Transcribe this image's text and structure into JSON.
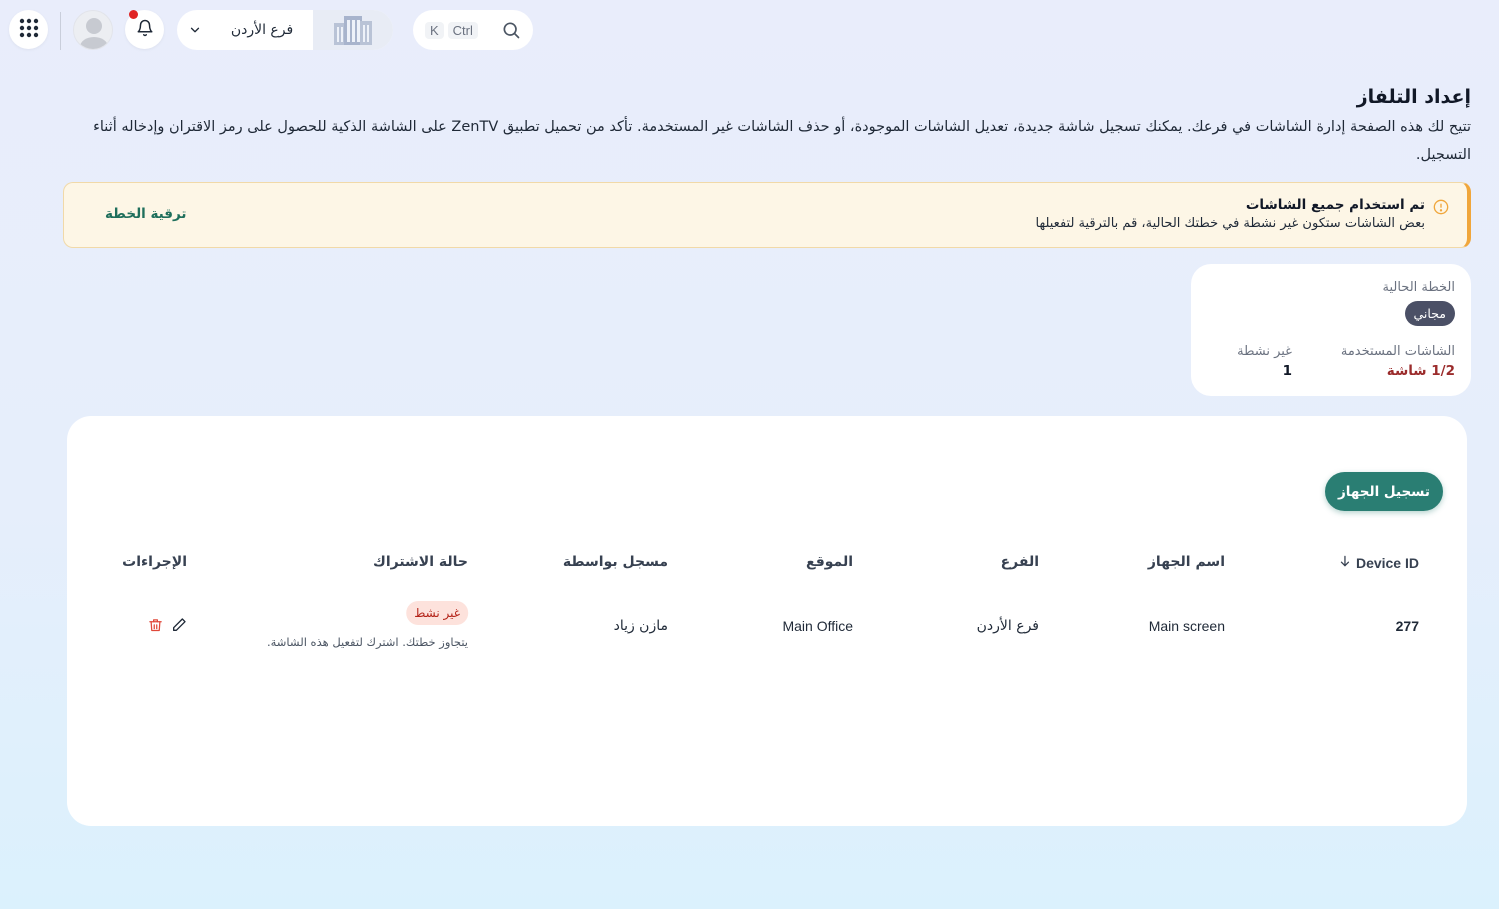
{
  "topbar": {
    "branch_name": "فرع الأردن",
    "search_kbd_ctrl": "Ctrl",
    "search_kbd_k": "K",
    "notification_dot_color": "#e02424"
  },
  "header": {
    "title": "إعداد التلفاز",
    "description": "تتيح لك هذه الصفحة إدارة الشاشات في فرعك. يمكنك تسجيل شاشة جديدة، تعديل الشاشات الموجودة، أو حذف الشاشات غير المستخدمة. تأكد من تحميل تطبيق ZenTV على الشاشة الذكية للحصول على رمز الاقتران وإدخاله أثناء التسجيل."
  },
  "alert": {
    "title": "تم استخدام جميع الشاشات",
    "text": "بعض الشاشات ستكون غير نشطة في خطتك الحالية، قم بالترقية لتفعيلها",
    "link": "ترقية الخطة",
    "accent_color": "#f0a63b"
  },
  "plan": {
    "current_label": "الخطة الحالية",
    "current_value": "مجاني",
    "used_label": "الشاشات المستخدمة",
    "used_value": "1/2 شاشة",
    "inactive_label": "غير نشطة",
    "inactive_value": "1"
  },
  "table": {
    "register_button": "تسجيل الجهاز",
    "columns": {
      "device_id": "Device ID",
      "device_name": "اسم الجهاز",
      "branch": "الفرع",
      "location": "الموقع",
      "registered_by": "مسجل بواسطة",
      "subscription_status": "حالة الاشتراك",
      "actions": "الإجراءات"
    },
    "rows": [
      {
        "device_id": "277",
        "device_name": "Main screen",
        "branch": "فرع الأردن",
        "location": "Main Office",
        "registered_by": "مازن زياد",
        "status": "غير نشط",
        "status_note": "يتجاوز خطتك. اشترك لتفعيل هذه الشاشة."
      }
    ],
    "primary_color": "#2a7e73"
  }
}
